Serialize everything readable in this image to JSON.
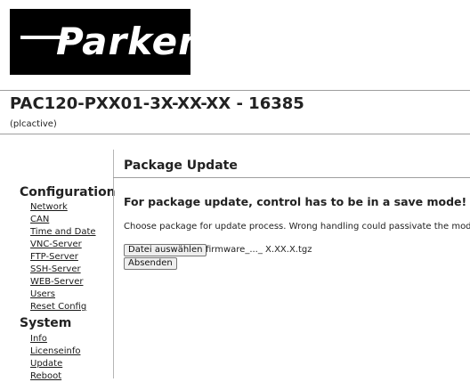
{
  "header": {
    "logo_text": "Parker",
    "device_title": "PAC120-PXX01-3X-XX-XX - 16385",
    "device_subtitle": "(plcactive)"
  },
  "sidebar": {
    "sections": [
      {
        "title": "Configuration",
        "links": [
          "Network",
          "CAN",
          "Time and Date",
          "VNC-Server",
          "FTP-Server",
          "SSH-Server",
          "WEB-Server",
          "Users",
          "Reset Config"
        ]
      },
      {
        "title": "System",
        "links": [
          "Info",
          "Licenseinfo",
          "Update",
          "Reboot"
        ]
      }
    ]
  },
  "main": {
    "title": "Package Update",
    "warning": "For package update, control has to be in a save mode!",
    "description": "Choose package for update process. Wrong handling could passivate the module.",
    "file_button_label": "Datei auswählen",
    "file_name": "firmware_..._ X.XX.X.tgz",
    "submit_label": "Absenden"
  }
}
